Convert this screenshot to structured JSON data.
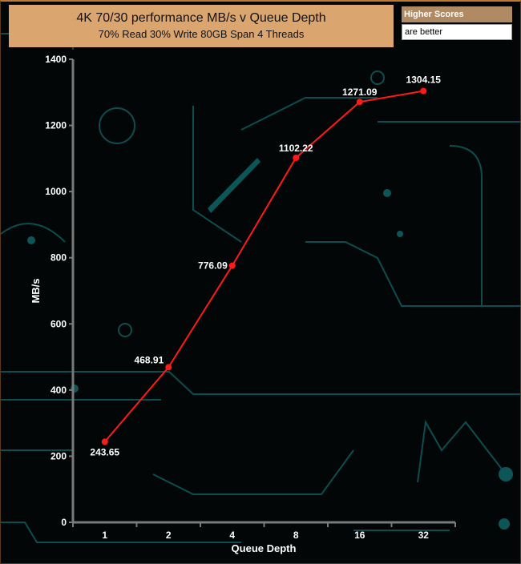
{
  "chart_data": {
    "type": "line",
    "title": "4K 70/30 performance MB/s v Queue Depth",
    "subtitle": "70% Read 30% Write 80GB Span 4 Threads",
    "legend": {
      "title": "Higher Scores",
      "subtitle": "are better",
      "placement": "top-right"
    },
    "xlabel": "Queue Depth",
    "ylabel": "MB/s",
    "categories": [
      "1",
      "2",
      "4",
      "8",
      "16",
      "32"
    ],
    "series": [
      {
        "name": "MB/s",
        "values": [
          243.65,
          468.91,
          776.09,
          1102.22,
          1271.09,
          1304.15
        ],
        "color": "#ff1a1a"
      }
    ],
    "data_labels": [
      "243.65",
      "468.91",
      "776.09",
      "1102.22",
      "1271.09",
      "1304.15"
    ],
    "ylim": [
      0,
      1400
    ],
    "yticks": [
      "0",
      "200",
      "400",
      "600",
      "800",
      "1000",
      "1200",
      "1400"
    ],
    "grid": false
  }
}
